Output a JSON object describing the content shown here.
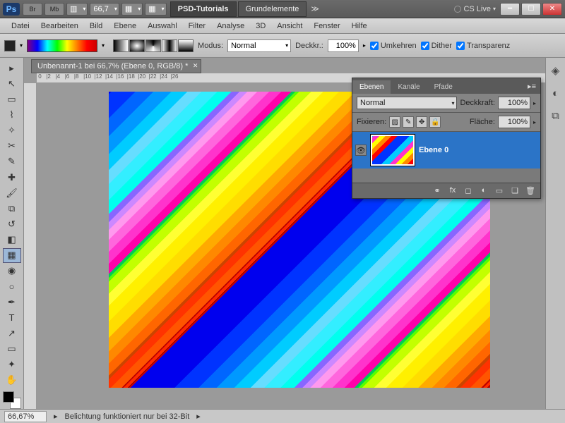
{
  "title": {
    "app": "Ps",
    "apps": [
      "Br",
      "Mb"
    ],
    "zoom": "66,7",
    "tab_active": "PSD-Tutorials",
    "tab_other": "Grundelemente",
    "cslive": "CS Live"
  },
  "menu": [
    "Datei",
    "Bearbeiten",
    "Bild",
    "Ebene",
    "Auswahl",
    "Filter",
    "Analyse",
    "3D",
    "Ansicht",
    "Fenster",
    "Hilfe"
  ],
  "opts": {
    "modus_label": "Modus:",
    "modus_val": "Normal",
    "deck_label": "Deckkr.:",
    "deck_val": "100%",
    "chk1": "Umkehren",
    "chk2": "Dither",
    "chk3": "Transparenz"
  },
  "doc": {
    "tab": "Unbenannt-1 bei 66,7% (Ebene 0, RGB/8) *"
  },
  "panel": {
    "tabs": [
      "Ebenen",
      "Kanäle",
      "Pfade"
    ],
    "blend": "Normal",
    "deck_label": "Deckkraft:",
    "deck_val": "100%",
    "fix_label": "Fixieren:",
    "fill_label": "Fläche:",
    "fill_val": "100%",
    "layer_name": "Ebene 0"
  },
  "status": {
    "zoom": "66,67%",
    "msg": "Belichtung funktioniert nur bei 32-Bit"
  }
}
